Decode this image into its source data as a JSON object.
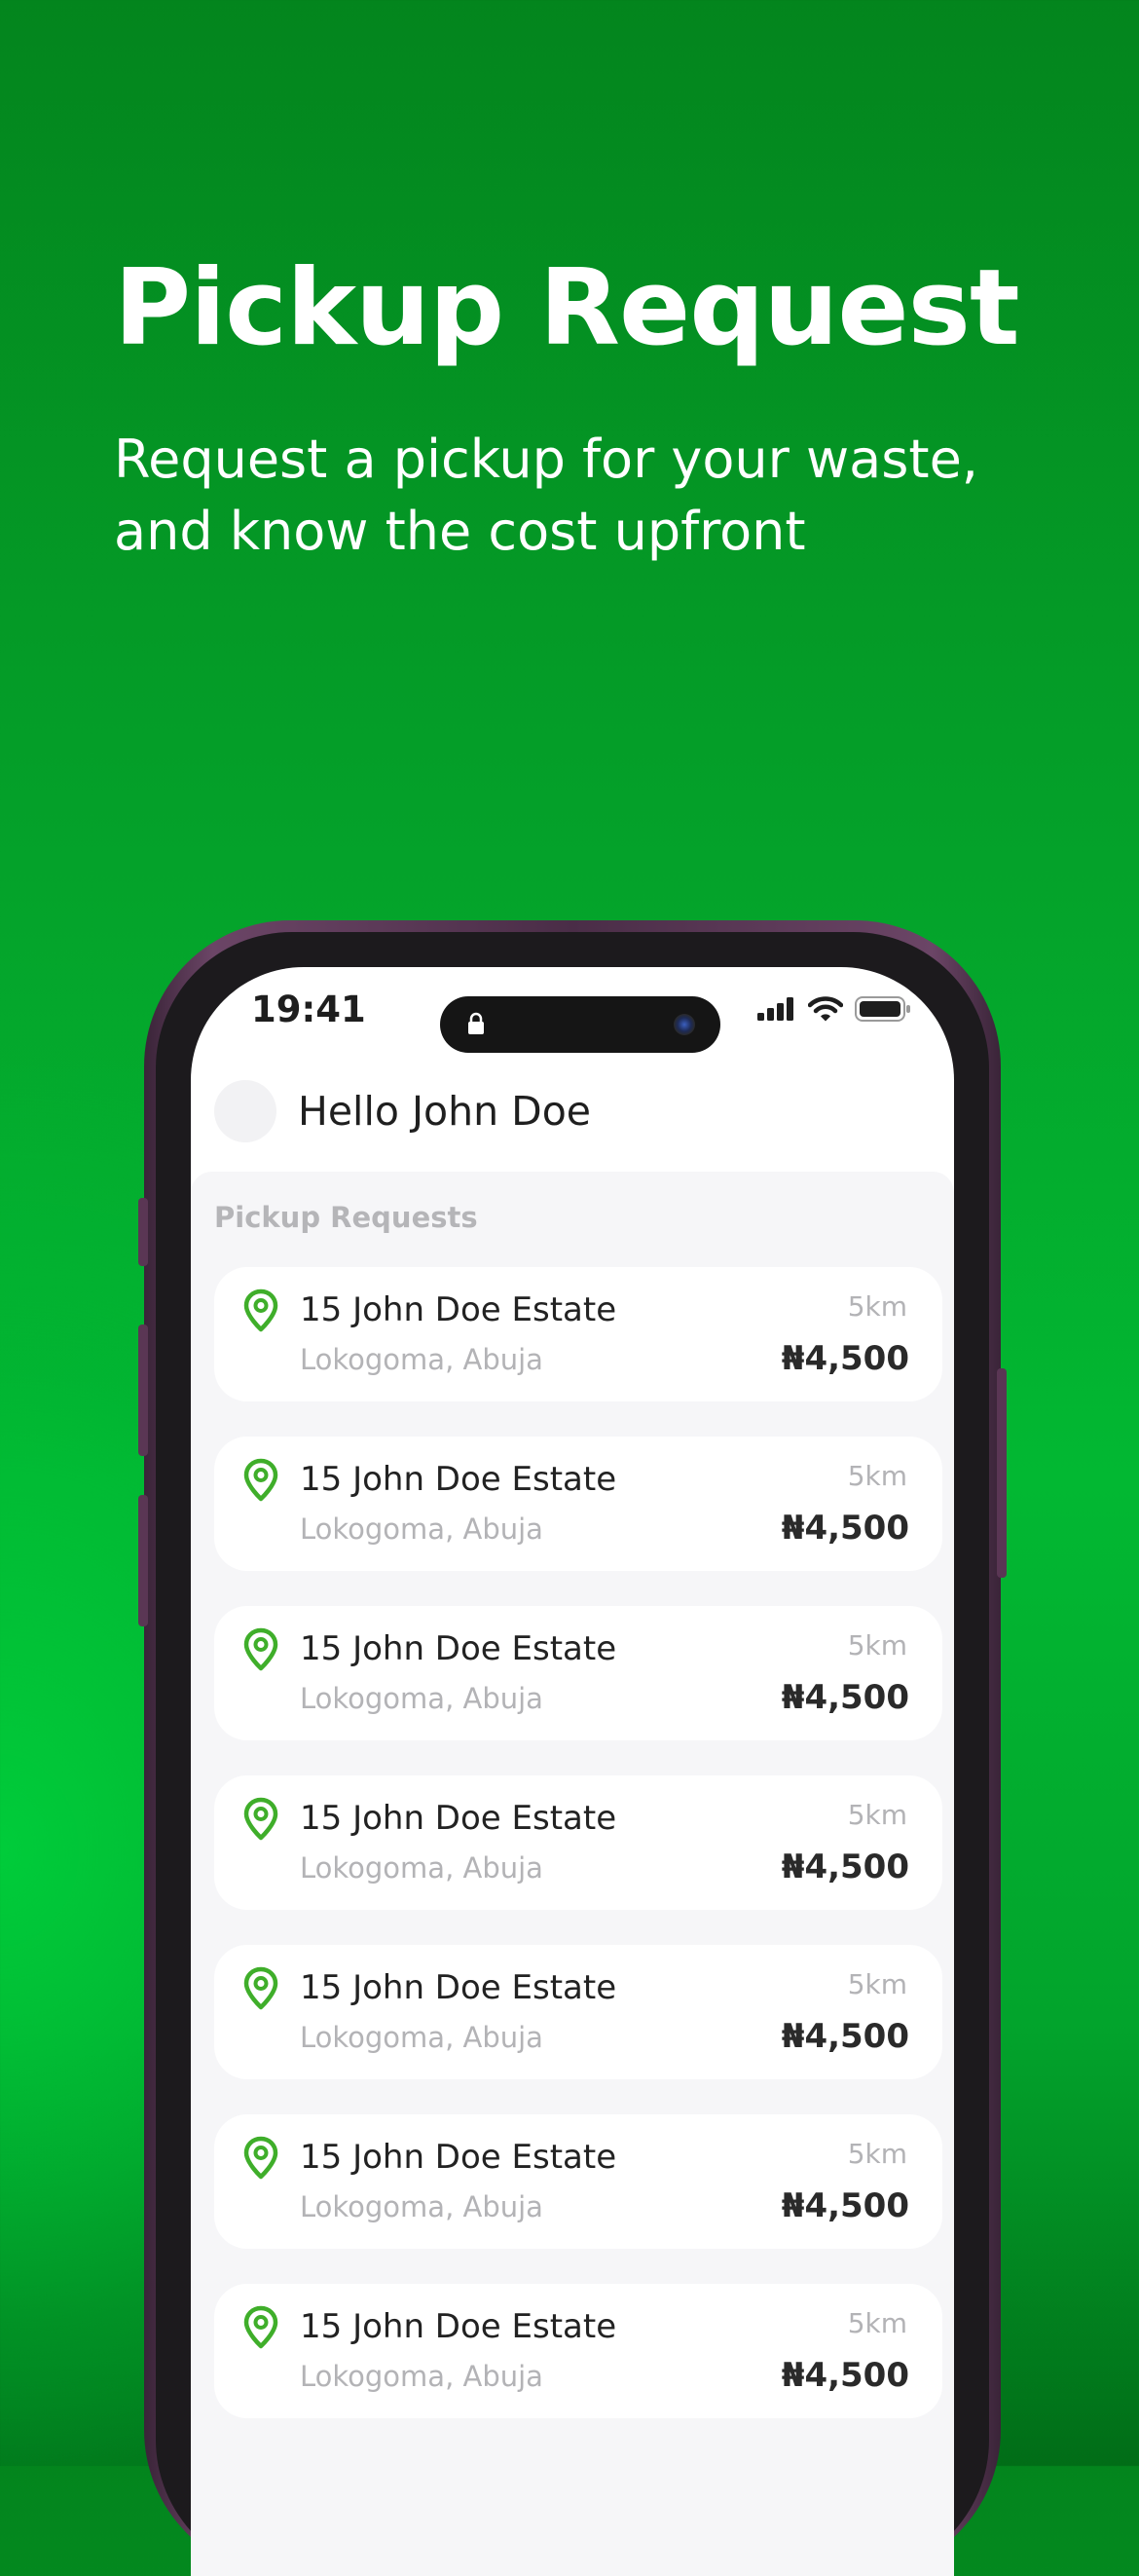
{
  "hero": {
    "title": "Pickup Request",
    "subtitle": "Request a pickup for your waste, and know the cost upfront"
  },
  "status_bar": {
    "time": "19:41",
    "icons": [
      "lock-icon",
      "signal-icon",
      "wifi-icon",
      "battery-icon"
    ]
  },
  "header": {
    "greeting": "Hello John Doe"
  },
  "section": {
    "title": "Pickup Requests"
  },
  "requests": [
    {
      "address": "15 John Doe Estate",
      "location": "Lokogoma, Abuja",
      "distance": "5km",
      "price": "₦4,500"
    },
    {
      "address": "15 John Doe Estate",
      "location": "Lokogoma, Abuja",
      "distance": "5km",
      "price": "₦4,500"
    },
    {
      "address": "15 John Doe Estate",
      "location": "Lokogoma, Abuja",
      "distance": "5km",
      "price": "₦4,500"
    },
    {
      "address": "15 John Doe Estate",
      "location": "Lokogoma, Abuja",
      "distance": "5km",
      "price": "₦4,500"
    },
    {
      "address": "15 John Doe Estate",
      "location": "Lokogoma, Abuja",
      "distance": "5km",
      "price": "₦4,500"
    },
    {
      "address": "15 John Doe Estate",
      "location": "Lokogoma, Abuja",
      "distance": "5km",
      "price": "₦4,500"
    },
    {
      "address": "15 John Doe Estate",
      "location": "Lokogoma, Abuja",
      "distance": "5km",
      "price": "₦4,500"
    }
  ],
  "colors": {
    "brand_green": "#04a22a",
    "pin_green": "#3fae2a"
  }
}
